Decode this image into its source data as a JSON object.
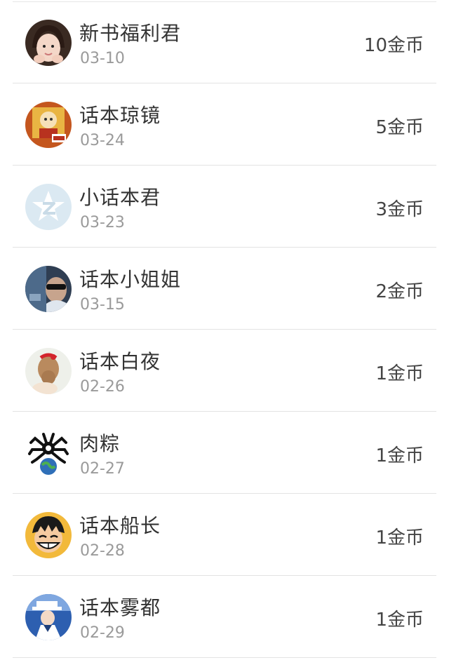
{
  "rows": [
    {
      "name": "新书福利君",
      "date": "03-10",
      "coins": "10金币",
      "avatar": "girl-portrait-avatar"
    },
    {
      "name": "话本琼镜",
      "date": "03-24",
      "coins": "5金币",
      "avatar": "cartoon-poster-avatar"
    },
    {
      "name": "小话本君",
      "date": "03-23",
      "coins": "3金币",
      "avatar": "qzone-star-avatar"
    },
    {
      "name": "话本小姐姐",
      "date": "03-15",
      "coins": "2金币",
      "avatar": "sunglasses-man-avatar"
    },
    {
      "name": "话本白夜",
      "date": "02-26",
      "coins": "1金币",
      "avatar": "braided-hair-avatar"
    },
    {
      "name": "肉粽",
      "date": "02-27",
      "coins": "1金币",
      "avatar": "spider-globe-avatar"
    },
    {
      "name": "话本船长",
      "date": "02-28",
      "coins": "1金币",
      "avatar": "straw-hat-pirate-avatar"
    },
    {
      "name": "话本雾都",
      "date": "02-29",
      "coins": "1金币",
      "avatar": "kaito-kid-avatar"
    }
  ]
}
